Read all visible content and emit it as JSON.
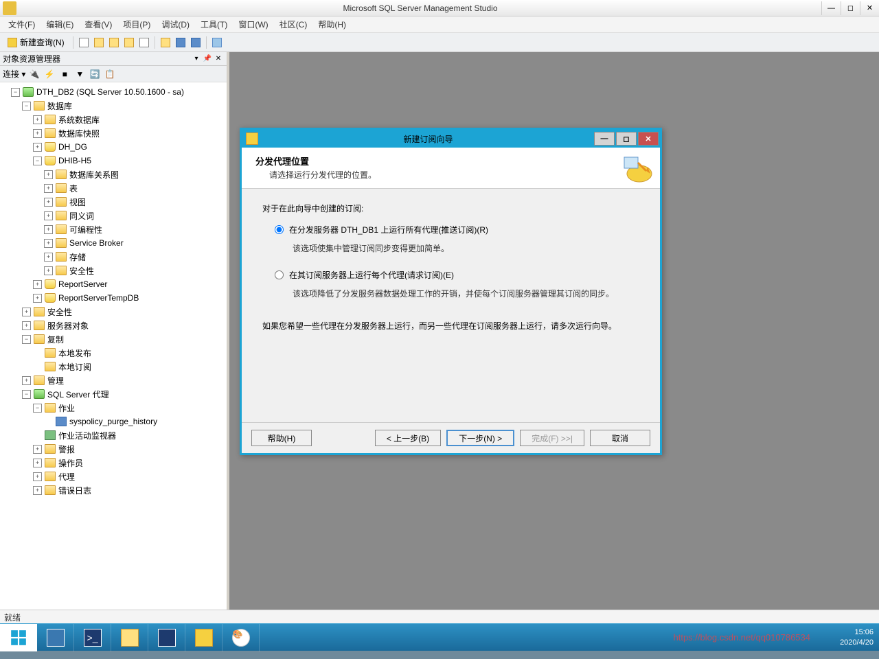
{
  "window": {
    "title": "Microsoft SQL Server Management Studio"
  },
  "menu": {
    "file": "文件(F)",
    "edit": "编辑(E)",
    "view": "查看(V)",
    "project": "项目(P)",
    "debug": "调试(D)",
    "tools": "工具(T)",
    "window": "窗口(W)",
    "community": "社区(C)",
    "help": "帮助(H)"
  },
  "toolbar": {
    "newquery": "新建查询(N)"
  },
  "explorer": {
    "title": "对象资源管理器",
    "connect": "连接 ▾",
    "root": "DTH_DB2 (SQL Server 10.50.1600 - sa)",
    "databases": "数据库",
    "sysdb": "系统数据库",
    "snapshots": "数据库快照",
    "dh_dg": "DH_DG",
    "dhib_h5": "DHIB-H5",
    "diagrams": "数据库关系图",
    "tables": "表",
    "views": "视图",
    "synonyms": "同义词",
    "programmability": "可编程性",
    "servicebroker": "Service Broker",
    "storage": "存储",
    "dbsecurity": "安全性",
    "reportserver": "ReportServer",
    "reportservertemp": "ReportServerTempDB",
    "security": "安全性",
    "serverobjects": "服务器对象",
    "replication": "复制",
    "localpub": "本地发布",
    "localsub": "本地订阅",
    "management": "管理",
    "agent": "SQL Server 代理",
    "jobs": "作业",
    "job1": "syspolicy_purge_history",
    "activitymonitor": "作业活动监视器",
    "alerts": "警报",
    "operators": "操作员",
    "proxies": "代理",
    "errorlogs": "错误日志"
  },
  "dialog": {
    "title": "新建订阅向导",
    "header_title": "分发代理位置",
    "header_sub": "请选择运行分发代理的位置。",
    "intro": "对于在此向导中创建的订阅:",
    "opt1": "在分发服务器 DTH_DB1 上运行所有代理(推送订阅)(R)",
    "opt1_desc": "该选项使集中管理订阅同步变得更加简单。",
    "opt2": "在其订阅服务器上运行每个代理(请求订阅)(E)",
    "opt2_desc": "该选项降低了分发服务器数据处理工作的开销，并使每个订阅服务器管理其订阅的同步。",
    "note": "如果您希望一些代理在分发服务器上运行，而另一些代理在订阅服务器上运行，请多次运行向导。",
    "btn_help": "帮助(H)",
    "btn_back": "< 上一步(B)",
    "btn_next": "下一步(N) >",
    "btn_finish": "完成(F) >>|",
    "btn_cancel": "取消"
  },
  "status": {
    "ready": "就绪"
  },
  "taskbar": {
    "time": "15:06",
    "date": "2020/4/20",
    "watermark": "https://blog.csdn.net/qq010786534"
  }
}
